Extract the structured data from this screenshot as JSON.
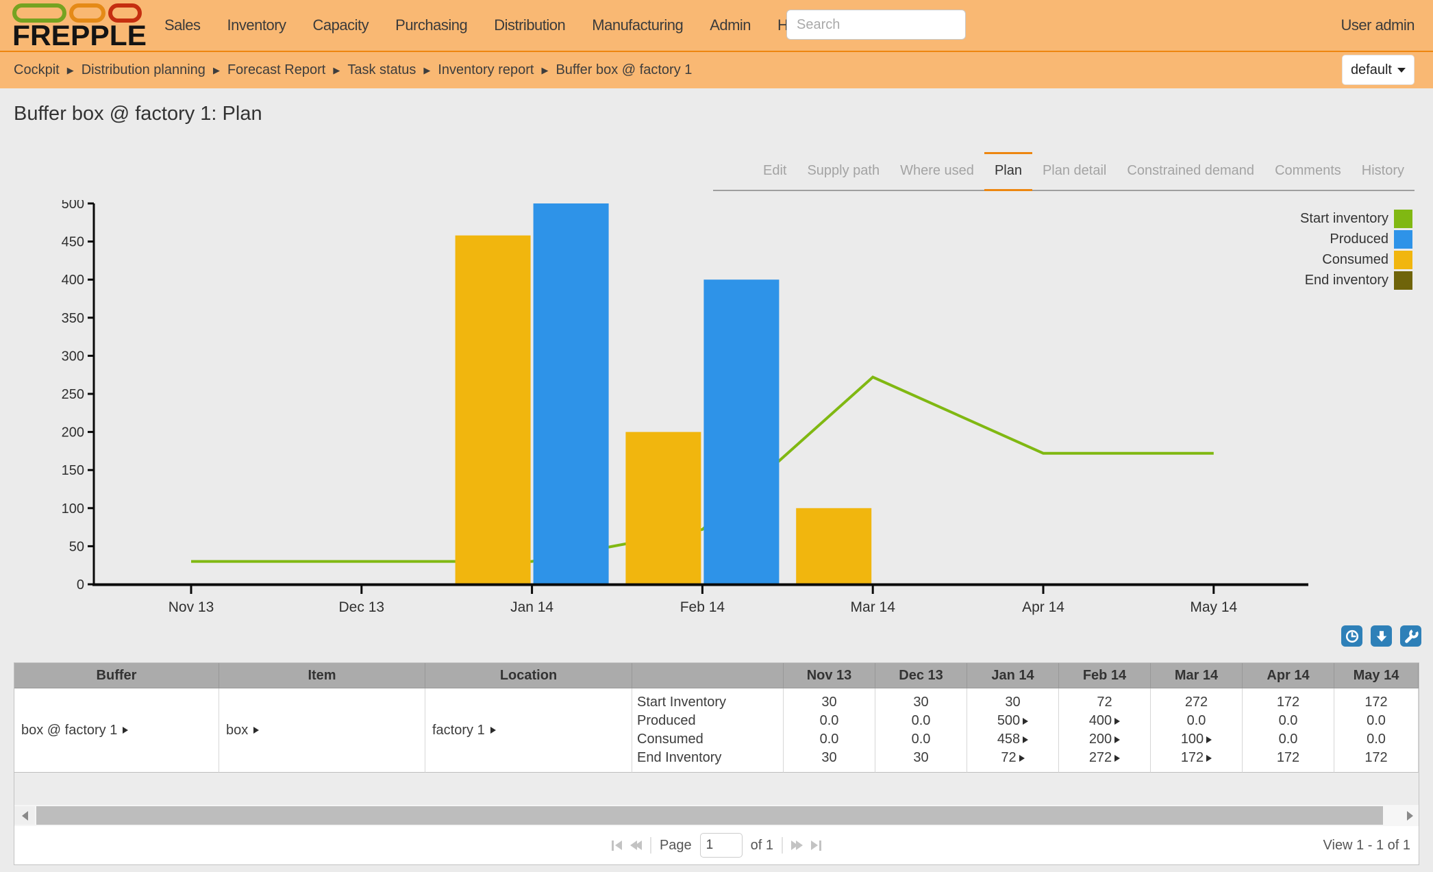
{
  "header": {
    "brand": "FREPPLE",
    "nav_items": [
      "Sales",
      "Inventory",
      "Capacity",
      "Purchasing",
      "Distribution",
      "Manufacturing",
      "Admin",
      "Help"
    ],
    "search_placeholder": "Search",
    "user_label": "User admin"
  },
  "breadcrumb": {
    "items": [
      "Cockpit",
      "Distribution planning",
      "Forecast Report",
      "Task status",
      "Inventory report",
      "Buffer box @ factory 1"
    ],
    "view_selector": "default"
  },
  "page": {
    "title": "Buffer box @ factory 1: Plan"
  },
  "tabs": {
    "items": [
      "Edit",
      "Supply path",
      "Where used",
      "Plan",
      "Plan detail",
      "Constrained demand",
      "Comments",
      "History"
    ],
    "active": "Plan"
  },
  "chart_data": {
    "type": "bar+line",
    "categories": [
      "Nov 13",
      "Dec 13",
      "Jan 14",
      "Feb 14",
      "Mar 14",
      "Apr 14",
      "May 14"
    ],
    "series": [
      {
        "name": "Start inventory",
        "type": "line",
        "color": "#80b812",
        "drawn": true,
        "values": [
          30,
          30,
          30,
          72,
          272,
          172,
          172
        ]
      },
      {
        "name": "Produced",
        "type": "bar",
        "color": "#2e93e8",
        "side": "right",
        "drawn": true,
        "values": [
          0,
          0,
          500,
          400,
          0,
          0,
          0
        ]
      },
      {
        "name": "Consumed",
        "type": "bar",
        "color": "#f1b60e",
        "side": "left",
        "drawn": true,
        "values": [
          0,
          0,
          458,
          200,
          100,
          0,
          0
        ]
      },
      {
        "name": "End inventory",
        "type": "line",
        "color": "#6f640a",
        "drawn": false,
        "values": [
          30,
          30,
          72,
          272,
          172,
          172,
          172
        ]
      }
    ],
    "legend_order": [
      "Start inventory",
      "Produced",
      "Consumed",
      "End inventory"
    ],
    "title": "",
    "xlabel": "",
    "ylabel": "",
    "ylim": [
      0,
      500
    ],
    "ytick": 50,
    "grid": false,
    "legend_position": "top-right",
    "axis_color": "#0a0a0a",
    "label_color": "#2f2f2f"
  },
  "chart_toolbar": [
    {
      "icon": "clock-icon"
    },
    {
      "icon": "download-arrow-icon"
    },
    {
      "icon": "wrench-icon"
    }
  ],
  "table": {
    "columns": [
      "Buffer",
      "Item",
      "Location",
      "",
      "Nov 13",
      "Dec 13",
      "Jan 14",
      "Feb 14",
      "Mar 14",
      "Apr 14",
      "May 14"
    ],
    "row": {
      "buffer": "box @ factory 1",
      "item": "box",
      "location": "factory 1",
      "metrics": [
        "Start Inventory",
        "Produced",
        "Consumed",
        "End Inventory"
      ],
      "cells": [
        [
          {
            "v": "30"
          },
          {
            "v": "30"
          },
          {
            "v": "30"
          },
          {
            "v": "72"
          },
          {
            "v": "272"
          },
          {
            "v": "172"
          },
          {
            "v": "172"
          }
        ],
        [
          {
            "v": "0.0"
          },
          {
            "v": "0.0"
          },
          {
            "v": "500",
            "a": true
          },
          {
            "v": "400",
            "a": true
          },
          {
            "v": "0.0"
          },
          {
            "v": "0.0"
          },
          {
            "v": "0.0"
          }
        ],
        [
          {
            "v": "0.0"
          },
          {
            "v": "0.0"
          },
          {
            "v": "458",
            "a": true
          },
          {
            "v": "200",
            "a": true
          },
          {
            "v": "100",
            "a": true
          },
          {
            "v": "0.0"
          },
          {
            "v": "0.0"
          }
        ],
        [
          {
            "v": "30"
          },
          {
            "v": "30"
          },
          {
            "v": "72",
            "a": true
          },
          {
            "v": "272",
            "a": true
          },
          {
            "v": "172",
            "a": true
          },
          {
            "v": "172"
          },
          {
            "v": "172"
          }
        ]
      ]
    }
  },
  "pagination": {
    "page_label": "Page",
    "page_value": "1",
    "of_label": "of 1",
    "view_label": "View 1 - 1 of 1"
  },
  "colors": {
    "nav_bg": "#f9b873",
    "nav_divider": "#ed860f",
    "page_bg": "#ebebeb",
    "tab_active_accent": "#ed860f",
    "table_header_bg": "#ababab",
    "toolbar_button_bg": "#2e80b8",
    "logo_green": "#76a321",
    "logo_orange": "#e58a17",
    "logo_red": "#c52e10"
  }
}
